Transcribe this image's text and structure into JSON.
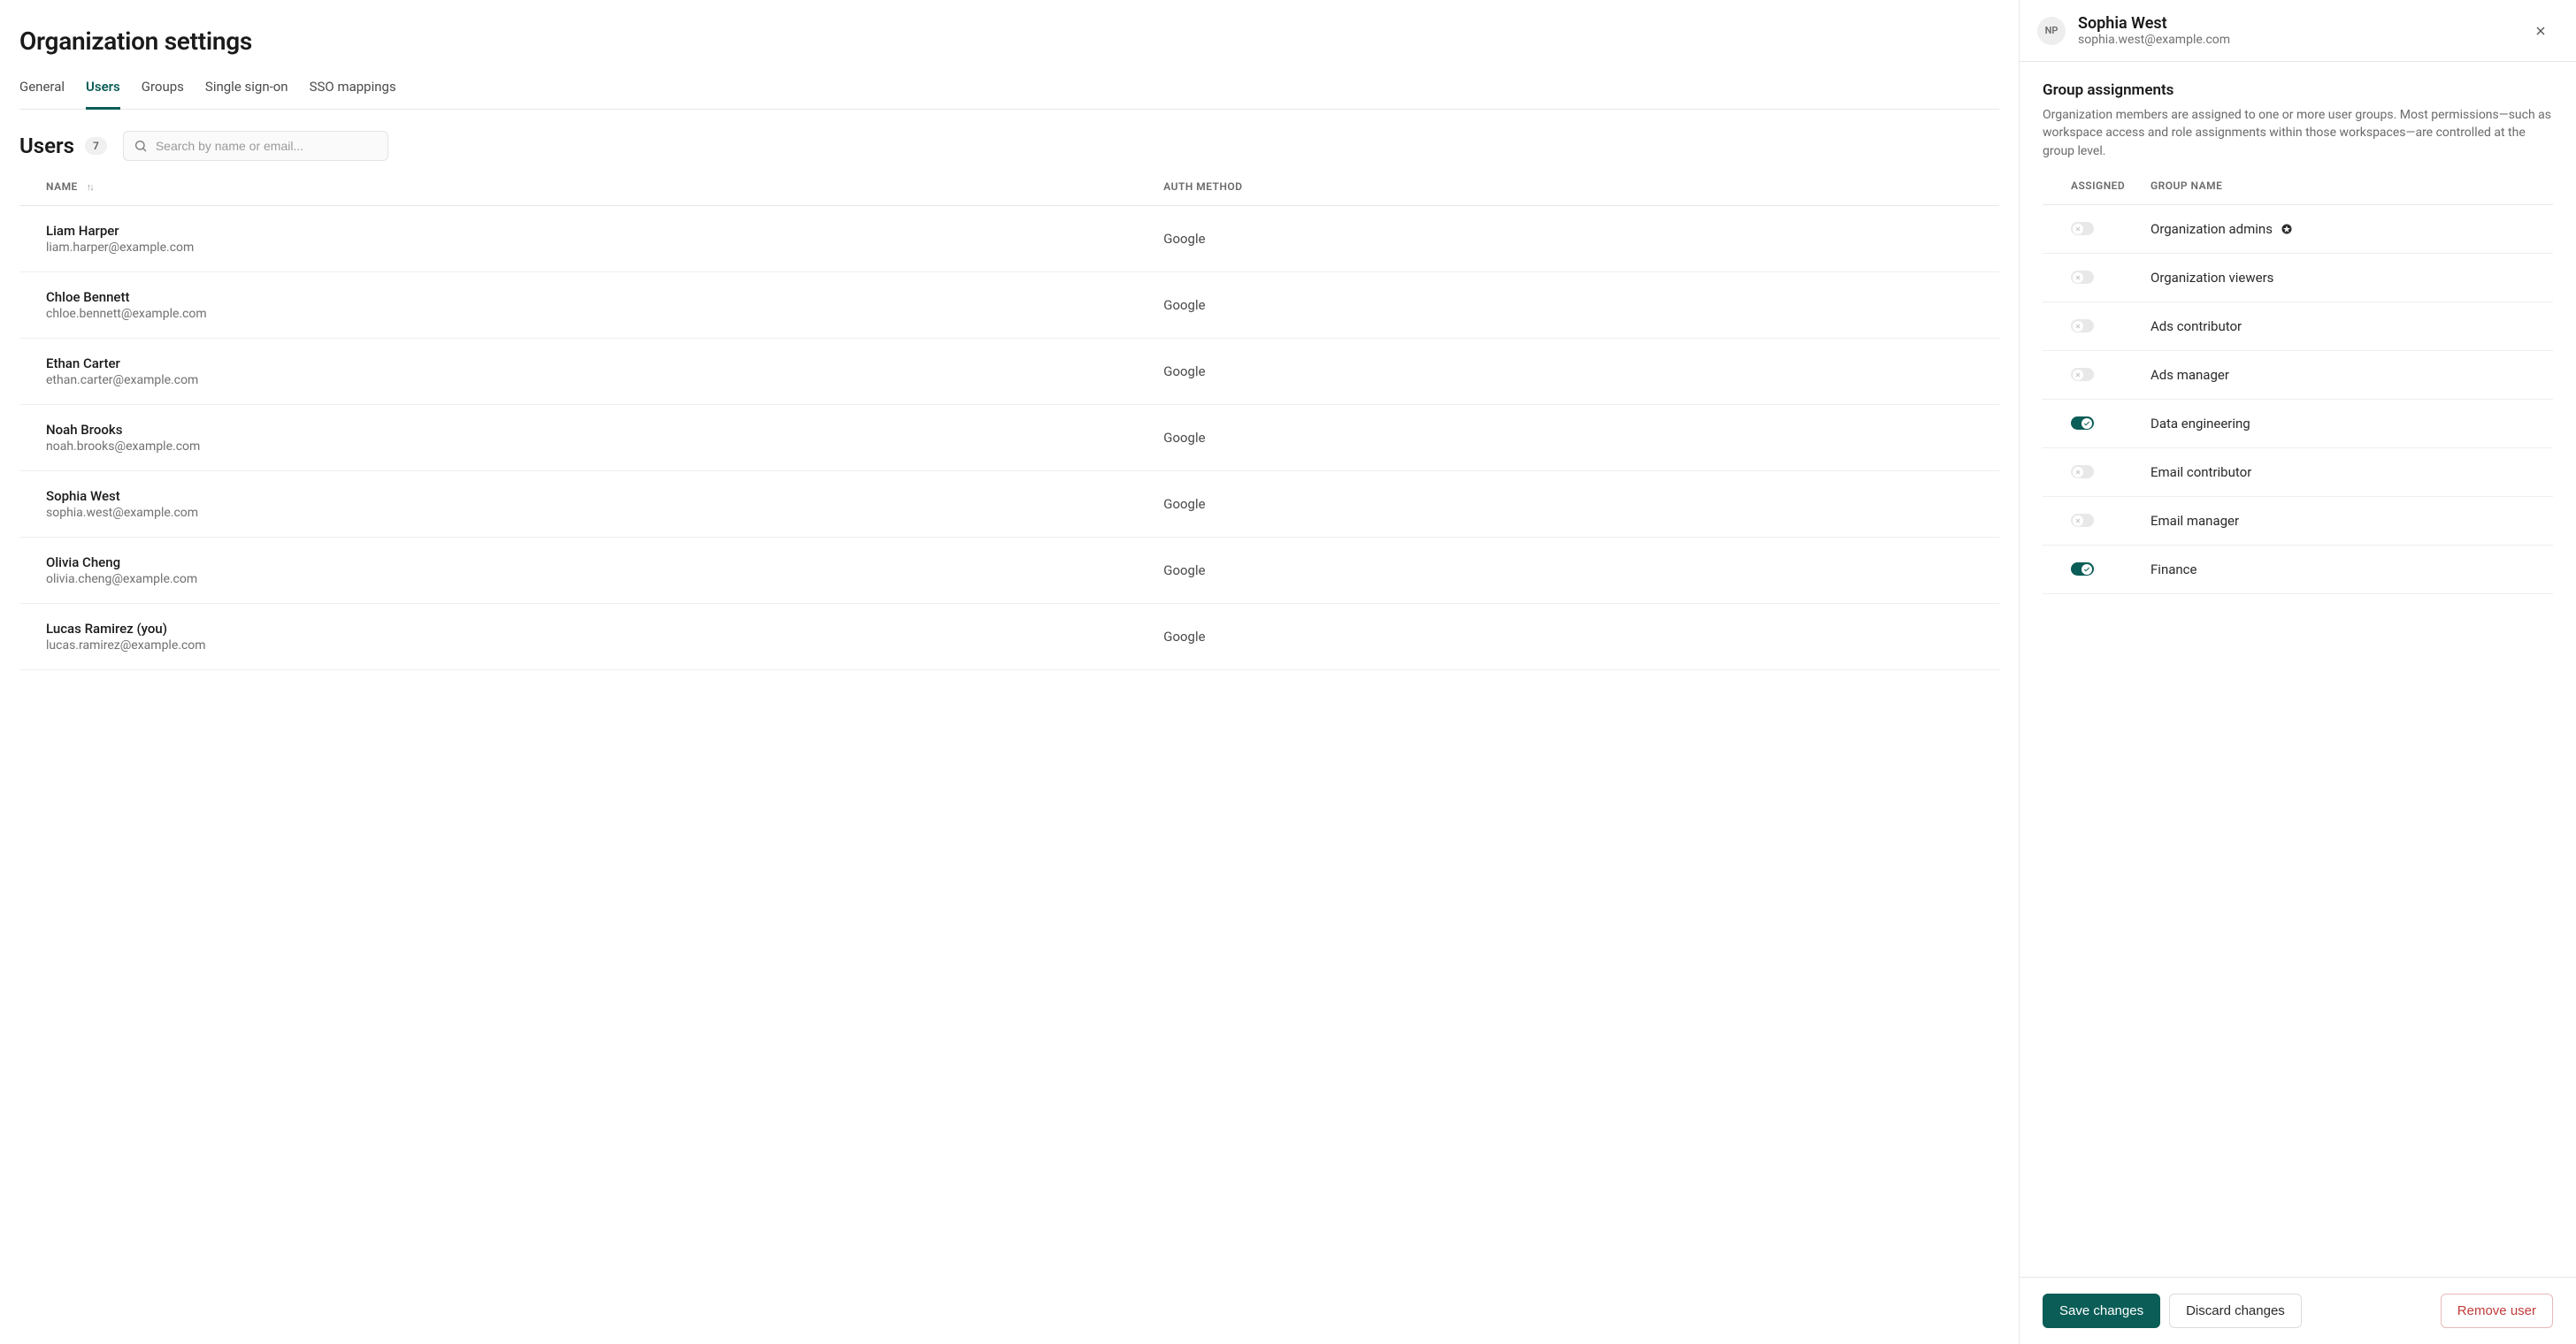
{
  "page_title": "Organization settings",
  "tabs": [
    {
      "label": "General",
      "active": false
    },
    {
      "label": "Users",
      "active": true
    },
    {
      "label": "Groups",
      "active": false
    },
    {
      "label": "Single sign-on",
      "active": false
    },
    {
      "label": "SSO mappings",
      "active": false
    }
  ],
  "users_section": {
    "title": "Users",
    "count": "7",
    "search_placeholder": "Search by name or email..."
  },
  "columns": {
    "name": "NAME",
    "auth": "AUTH METHOD"
  },
  "users": [
    {
      "name": "Liam Harper",
      "email": "liam.harper@example.com",
      "auth": "Google"
    },
    {
      "name": "Chloe Bennett",
      "email": "chloe.bennett@example.com",
      "auth": "Google"
    },
    {
      "name": "Ethan Carter",
      "email": "ethan.carter@example.com",
      "auth": "Google"
    },
    {
      "name": "Noah Brooks",
      "email": "noah.brooks@example.com",
      "auth": "Google"
    },
    {
      "name": "Sophia West",
      "email": "sophia.west@example.com",
      "auth": "Google"
    },
    {
      "name": "Olivia Cheng",
      "email": "olivia.cheng@example.com",
      "auth": "Google"
    },
    {
      "name": "Lucas Ramirez (you)",
      "email": "lucas.ramirez@example.com",
      "auth": "Google"
    }
  ],
  "panel": {
    "avatar_initials": "NP",
    "user_name": "Sophia West",
    "user_email": "sophia.west@example.com",
    "section_title": "Group assignments",
    "section_desc": "Organization members are assigned to one or more user groups. Most permissions—such as workspace access and role assignments within those workspaces—are controlled at the group level.",
    "group_columns": {
      "assigned": "ASSIGNED",
      "name": "GROUP NAME"
    },
    "groups": [
      {
        "name": "Organization admins",
        "assigned": false,
        "starred": true
      },
      {
        "name": "Organization viewers",
        "assigned": false,
        "starred": false
      },
      {
        "name": "Ads contributor",
        "assigned": false,
        "starred": false
      },
      {
        "name": "Ads manager",
        "assigned": false,
        "starred": false
      },
      {
        "name": "Data engineering",
        "assigned": true,
        "starred": false
      },
      {
        "name": "Email contributor",
        "assigned": false,
        "starred": false
      },
      {
        "name": "Email manager",
        "assigned": false,
        "starred": false
      },
      {
        "name": "Finance",
        "assigned": true,
        "starred": false
      }
    ],
    "buttons": {
      "save": "Save changes",
      "discard": "Discard changes",
      "remove": "Remove user"
    }
  }
}
